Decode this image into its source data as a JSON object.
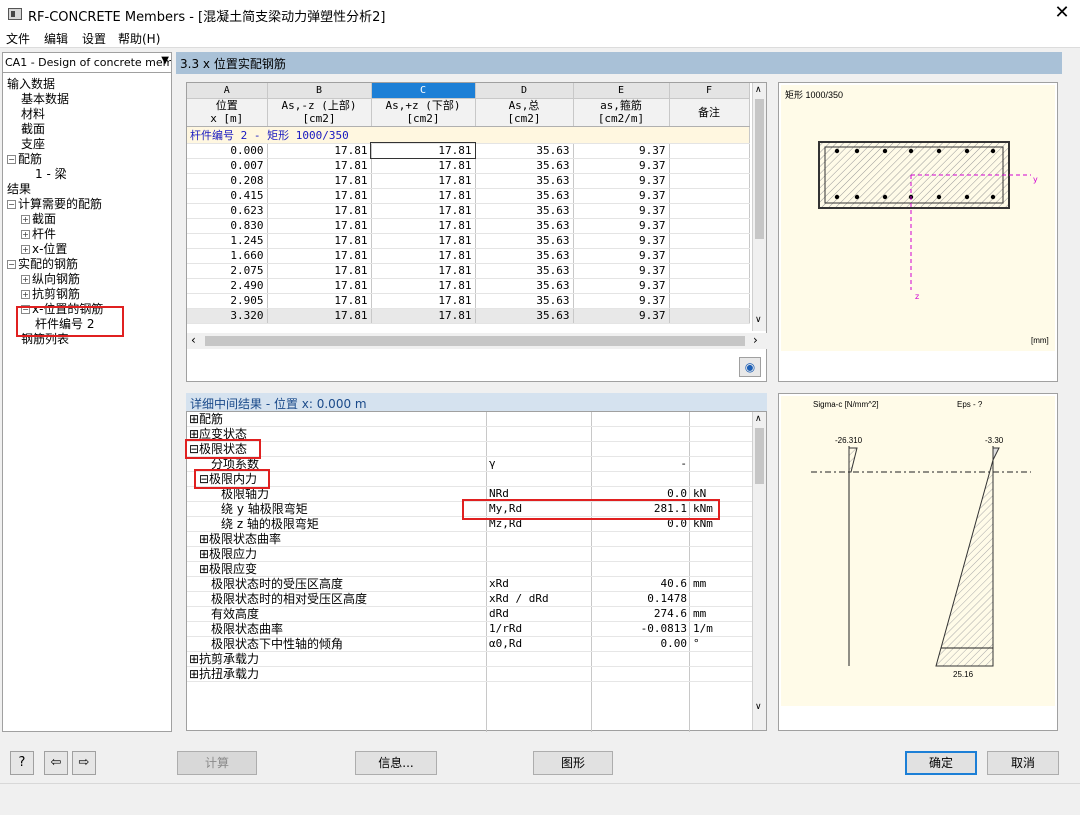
{
  "window": {
    "title": "RF-CONCRETE Members - [混凝土简支梁动力弹塑性分析2]",
    "close": "✕"
  },
  "menu": [
    "文件",
    "编辑",
    "设置",
    "帮助(H)"
  ],
  "case_select": "CA1 - Design of concrete mem",
  "tree": [
    {
      "label": "输入数据",
      "indent": 0,
      "toggle": ""
    },
    {
      "label": "基本数据",
      "indent": 1,
      "toggle": ""
    },
    {
      "label": "材料",
      "indent": 1,
      "toggle": ""
    },
    {
      "label": "截面",
      "indent": 1,
      "toggle": ""
    },
    {
      "label": "支座",
      "indent": 1,
      "toggle": ""
    },
    {
      "label": "配筋",
      "indent": 0,
      "toggle": "−"
    },
    {
      "label": "1 - 梁",
      "indent": 2,
      "toggle": ""
    },
    {
      "label": "结果",
      "indent": 0,
      "toggle": ""
    },
    {
      "label": "计算需要的配筋",
      "indent": 0,
      "toggle": "−"
    },
    {
      "label": "截面",
      "indent": 1,
      "toggle": "+"
    },
    {
      "label": "杆件",
      "indent": 1,
      "toggle": "+"
    },
    {
      "label": "x-位置",
      "indent": 1,
      "toggle": "+"
    },
    {
      "label": "实配的钢筋",
      "indent": 0,
      "toggle": "−"
    },
    {
      "label": "纵向钢筋",
      "indent": 1,
      "toggle": "+"
    },
    {
      "label": "抗剪钢筋",
      "indent": 1,
      "toggle": "+"
    },
    {
      "label": "x-位置的钢筋",
      "indent": 1,
      "toggle": "−"
    },
    {
      "label": "杆件编号 2",
      "indent": 2,
      "toggle": ""
    },
    {
      "label": "钢筋列表",
      "indent": 1,
      "toggle": ""
    }
  ],
  "section_title": "3.3 x 位置实配钢筋",
  "grid": {
    "col_letters": [
      "A",
      "B",
      "C",
      "D",
      "E",
      "F"
    ],
    "headers": [
      [
        "位置",
        "x [m]"
      ],
      [
        "As,-z (上部)",
        "[cm2]"
      ],
      [
        "As,+z (下部)",
        "[cm2]"
      ],
      [
        "As,总",
        "[cm2]"
      ],
      [
        "as,箍筋",
        "[cm2/m]"
      ],
      [
        "",
        "备注"
      ]
    ],
    "member_row": "杆件编号 2  -  矩形 1000/350",
    "rows": [
      [
        "0.000",
        "17.81",
        "17.81",
        "35.63",
        "9.37",
        ""
      ],
      [
        "0.007",
        "17.81",
        "17.81",
        "35.63",
        "9.37",
        ""
      ],
      [
        "0.208",
        "17.81",
        "17.81",
        "35.63",
        "9.37",
        ""
      ],
      [
        "0.415",
        "17.81",
        "17.81",
        "35.63",
        "9.37",
        ""
      ],
      [
        "0.623",
        "17.81",
        "17.81",
        "35.63",
        "9.37",
        ""
      ],
      [
        "0.830",
        "17.81",
        "17.81",
        "35.63",
        "9.37",
        ""
      ],
      [
        "1.245",
        "17.81",
        "17.81",
        "35.63",
        "9.37",
        ""
      ],
      [
        "1.660",
        "17.81",
        "17.81",
        "35.63",
        "9.37",
        ""
      ],
      [
        "2.075",
        "17.81",
        "17.81",
        "35.63",
        "9.37",
        ""
      ],
      [
        "2.490",
        "17.81",
        "17.81",
        "35.63",
        "9.37",
        ""
      ],
      [
        "2.905",
        "17.81",
        "17.81",
        "35.63",
        "9.37",
        ""
      ],
      [
        "3.320",
        "17.81",
        "17.81",
        "35.63",
        "9.37",
        ""
      ]
    ]
  },
  "sketch1": {
    "title": "矩形 1000/350",
    "unit": "[mm]",
    "axis_y": "y",
    "axis_z": "z"
  },
  "detail_title": "详细中间结果 - 位置 x: 0.000 m",
  "detail_rows": [
    {
      "c1": "⊞配筋",
      "c2": "",
      "c3": "",
      "c4": "",
      "lvl": 0
    },
    {
      "c1": "⊞应变状态",
      "c2": "",
      "c3": "",
      "c4": "",
      "lvl": 0
    },
    {
      "c1": "⊟极限状态",
      "c2": "",
      "c3": "",
      "c4": "",
      "lvl": 0
    },
    {
      "c1": "分项系数",
      "c2": "γ",
      "c3": "-",
      "c4": "",
      "lvl": 2
    },
    {
      "c1": "⊟极限内力",
      "c2": "",
      "c3": "",
      "c4": "",
      "lvl": 1
    },
    {
      "c1": "极限轴力",
      "c2": "NRd",
      "c3": "0.0",
      "c4": "kN",
      "lvl": 3
    },
    {
      "c1": "绕 y 轴极限弯矩",
      "c2": "My,Rd",
      "c3": "281.1",
      "c4": "kNm",
      "lvl": 3
    },
    {
      "c1": "绕 z 轴的极限弯矩",
      "c2": "Mz,Rd",
      "c3": "0.0",
      "c4": "kNm",
      "lvl": 3
    },
    {
      "c1": "⊞极限状态曲率",
      "c2": "",
      "c3": "",
      "c4": "",
      "lvl": 1
    },
    {
      "c1": "⊞极限应力",
      "c2": "",
      "c3": "",
      "c4": "",
      "lvl": 1
    },
    {
      "c1": "⊞极限应变",
      "c2": "",
      "c3": "",
      "c4": "",
      "lvl": 1
    },
    {
      "c1": "极限状态时的受压区高度",
      "c2": "xRd",
      "c3": "40.6",
      "c4": "mm",
      "lvl": 2
    },
    {
      "c1": "极限状态时的相对受压区高度",
      "c2": "xRd / dRd",
      "c3": "0.1478",
      "c4": "",
      "lvl": 2
    },
    {
      "c1": "有效高度",
      "c2": "dRd",
      "c3": "274.6",
      "c4": "mm",
      "lvl": 2
    },
    {
      "c1": "极限状态曲率",
      "c2": "1/rRd",
      "c3": "-0.0813",
      "c4": "1/m",
      "lvl": 2
    },
    {
      "c1": "极限状态下中性轴的倾角",
      "c2": "α0,Rd",
      "c3": "0.00",
      "c4": "°",
      "lvl": 2
    },
    {
      "c1": "⊞抗剪承载力",
      "c2": "",
      "c3": "",
      "c4": "",
      "lvl": 0
    },
    {
      "c1": "⊞抗扭承载力",
      "c2": "",
      "c3": "",
      "c4": "",
      "lvl": 0
    }
  ],
  "sketch2": {
    "sigma_label": "Sigma-c [N/mm^2]",
    "eps_label": "Eps - ?",
    "val_left": "-26.310",
    "val_right": "-3.30",
    "val_bottom": "25.16"
  },
  "buttons": {
    "calc": "计算",
    "info": "信息...",
    "graphic": "图形",
    "ok": "确定",
    "cancel": "取消"
  },
  "icon_glyphs": {
    "help": "?",
    "prev": "⇦",
    "next": "⇨",
    "eye": "◉"
  }
}
